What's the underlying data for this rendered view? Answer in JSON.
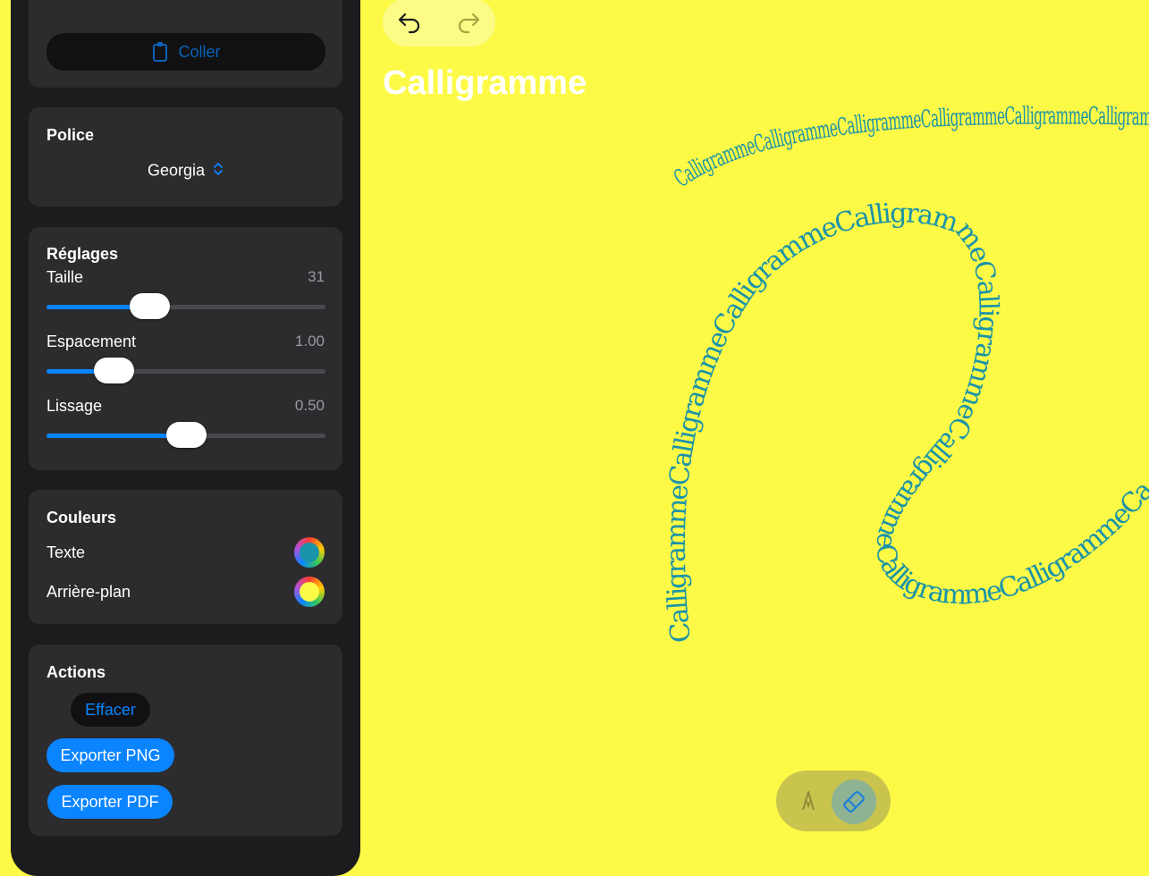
{
  "sidebar": {
    "paste_label": "Coller",
    "font_section": {
      "title": "Police",
      "selected_font": "Georgia"
    },
    "settings": {
      "title": "Réglages",
      "sliders": [
        {
          "label": "Taille",
          "value": "31",
          "fraction": 0.37
        },
        {
          "label": "Espacement",
          "value": "1.00",
          "fraction": 0.24
        },
        {
          "label": "Lissage",
          "value": "0.50",
          "fraction": 0.5
        }
      ]
    },
    "colors": {
      "title": "Couleurs",
      "text_label": "Texte",
      "text_color": "#1b93a8",
      "background_label": "Arrière-plan",
      "background_color": "#fcfa46"
    },
    "actions": {
      "title": "Actions",
      "clear_label": "Effacer",
      "export_png_label": "Exporter PNG",
      "export_pdf_label": "Exporter PDF"
    }
  },
  "toolbar": {
    "undo_icon": "undo-arrow-icon",
    "redo_icon": "redo-arrow-icon"
  },
  "canvas": {
    "title": "Calligramme",
    "path_text": "Calligramme",
    "text_color": "#1b93a8",
    "background_color": "#fcfa46"
  },
  "tools": {
    "pen_icon": "pen-tip-icon",
    "eraser_icon": "eraser-icon",
    "active_tool": "eraser"
  },
  "colors": {
    "accent": "#0a84ff",
    "sidebar_bg": "#1c1c1e",
    "card_bg": "#2c2c2e"
  }
}
